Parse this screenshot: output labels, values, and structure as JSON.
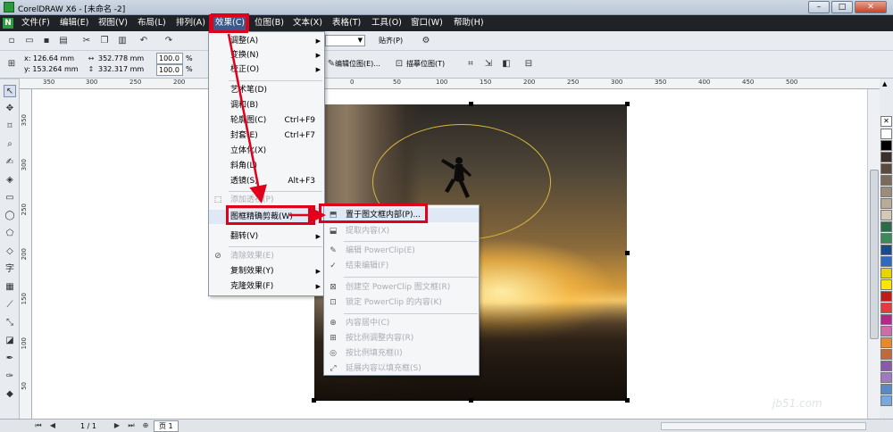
{
  "window": {
    "title": "CorelDRAW X6 - [未命名 -2]",
    "minimize": "–",
    "maximize": "□",
    "close": "✕"
  },
  "menubar": {
    "items": [
      {
        "label": "文件(F)"
      },
      {
        "label": "编辑(E)"
      },
      {
        "label": "视图(V)"
      },
      {
        "label": "布局(L)"
      },
      {
        "label": "排列(A)"
      },
      {
        "label": "效果(C)"
      },
      {
        "label": "位图(B)"
      },
      {
        "label": "文本(X)"
      },
      {
        "label": "表格(T)"
      },
      {
        "label": "工具(O)"
      },
      {
        "label": "窗口(W)"
      },
      {
        "label": "帮助(H)"
      }
    ]
  },
  "toolbar": {
    "snap_label": "贴齐(P)"
  },
  "property_bar": {
    "x": "x: 126.64 mm",
    "y": "y: 153.264 mm",
    "width": "352.778 mm",
    "height": "332.317 mm",
    "scale_x": "100.0",
    "scale_y": "100.0",
    "percent_x": "%",
    "percent_y": "%",
    "edit_bitmap": "编辑位图(E)...",
    "trace_bitmap": "描摹位图(T)"
  },
  "rulers": {
    "h_labels": [
      "350",
      "300",
      "250",
      "200",
      "150",
      "100",
      "50",
      "0",
      "50",
      "100",
      "150",
      "200",
      "250",
      "300",
      "350",
      "400",
      "450",
      "500"
    ],
    "v_labels": [
      "350",
      "300",
      "250",
      "200",
      "150",
      "100",
      "50"
    ]
  },
  "effects_menu": {
    "items": [
      {
        "label": "调整(A)",
        "submenu": true
      },
      {
        "label": "变换(N)",
        "submenu": true
      },
      {
        "label": "校正(O)",
        "submenu": true
      },
      {
        "label": "艺术笔(D)"
      },
      {
        "label": "调和(B)"
      },
      {
        "label": "轮廓图(C)",
        "shortcut": "Ctrl+F9"
      },
      {
        "label": "封套(E)",
        "shortcut": "Ctrl+F7"
      },
      {
        "label": "立体化(X)"
      },
      {
        "label": "斜角(L)"
      },
      {
        "label": "透镜(S)",
        "shortcut": "Alt+F3"
      },
      {
        "label": "添加透视(P)",
        "disabled": true
      },
      {
        "label": "图框精确剪裁(W)",
        "submenu": true
      },
      {
        "label": "翻转(V)",
        "submenu": true
      },
      {
        "label": "清除效果(E)",
        "disabled": true
      },
      {
        "label": "复制效果(Y)",
        "submenu": true
      },
      {
        "label": "克隆效果(F)",
        "submenu": true
      }
    ]
  },
  "powerclip_menu": {
    "items": [
      {
        "label": "置于图文框内部(P)..."
      },
      {
        "label": "提取内容(X)",
        "disabled": true
      },
      {
        "label": "编辑 PowerClip(E)",
        "disabled": true
      },
      {
        "label": "结束编辑(F)",
        "disabled": true
      },
      {
        "label": "创建空 PowerClip 图文框(R)",
        "disabled": true
      },
      {
        "label": "锁定 PowerClip 的内容(K)",
        "disabled": true
      },
      {
        "label": "内容居中(C)",
        "disabled": true
      },
      {
        "label": "按比例调整内容(R)",
        "disabled": true
      },
      {
        "label": "按比例填充框(I)",
        "disabled": true
      },
      {
        "label": "延展内容以填充框(S)",
        "disabled": true
      }
    ]
  },
  "statusbar": {
    "page_count": "1 / 1",
    "page_tab": "页 1"
  },
  "palette_colors": [
    "#ffffff",
    "#000000",
    "#3b2f2a",
    "#5a4a3e",
    "#7a6a5a",
    "#9c8c7a",
    "#b8ab98",
    "#d4c8b6",
    "#2c6a4a",
    "#3b8a5a",
    "#1a4a8a",
    "#2f6abf",
    "#e8d400",
    "#ffe600",
    "#c01b1b",
    "#e3393f",
    "#b02a8a",
    "#d06aa8",
    "#e88a2a",
    "#c06a3a",
    "#8a5aa8",
    "#a07ac0",
    "#5a8ac0",
    "#7aa8d8"
  ],
  "watermark": "jb51.com"
}
